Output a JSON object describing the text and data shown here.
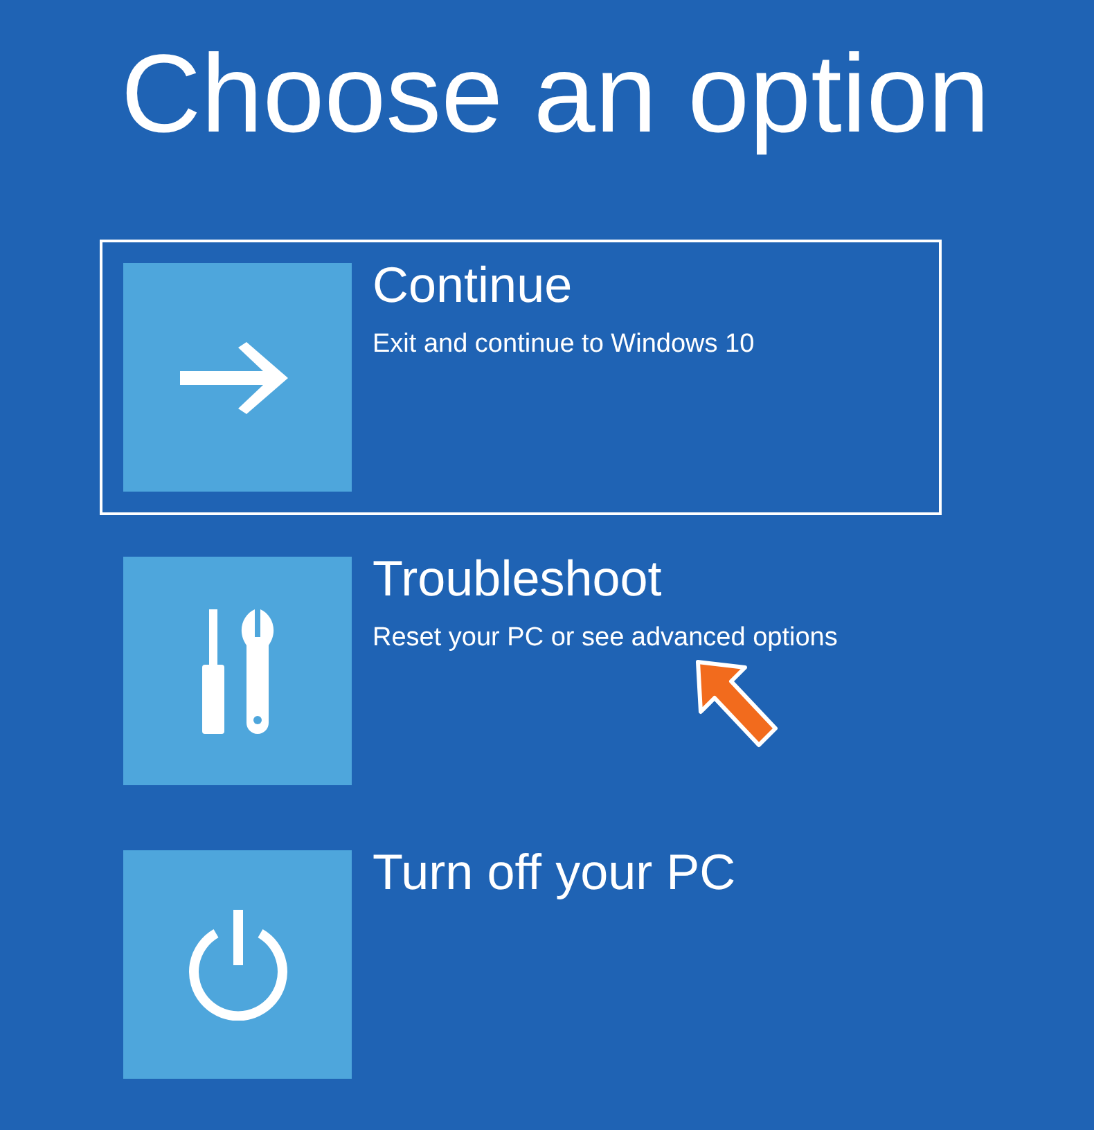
{
  "title": "Choose an option",
  "options": [
    {
      "kind": "continue",
      "label": "Continue",
      "description": "Exit and continue to Windows 10",
      "selected": true
    },
    {
      "kind": "troubleshoot",
      "label": "Troubleshoot",
      "description": "Reset your PC or see advanced options",
      "selected": false
    },
    {
      "kind": "power",
      "label": "Turn off your PC",
      "selected": false
    }
  ]
}
